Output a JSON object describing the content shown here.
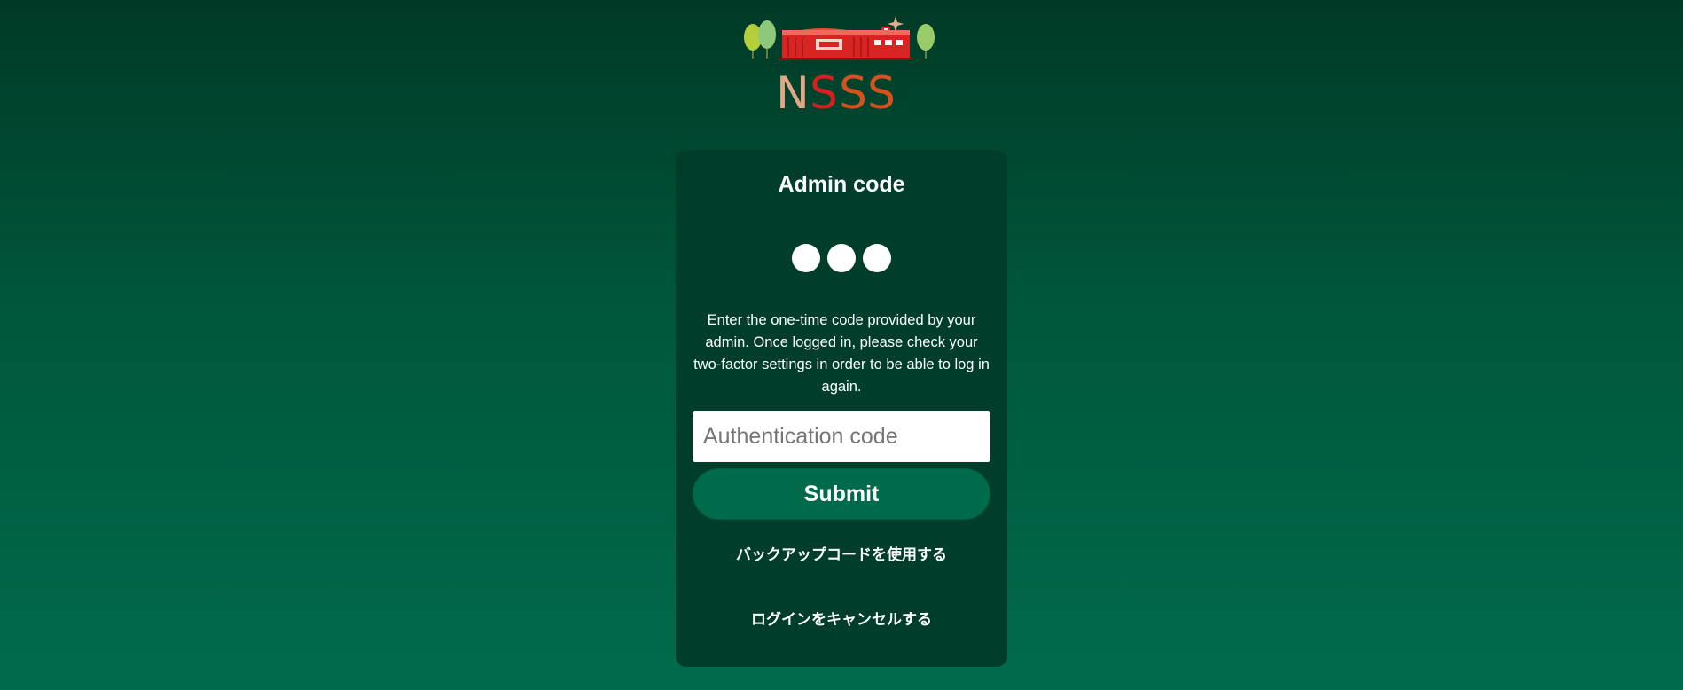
{
  "brand": {
    "logo_letters": [
      "N",
      "S",
      "S",
      "S"
    ],
    "letter_colors": [
      "#e0a888",
      "#d42020",
      "#d4521e",
      "#d4521e"
    ]
  },
  "card": {
    "title": "Admin code",
    "description": "Enter the one-time code provided by your admin. Once logged in, please check your two-factor settings in order to be able to log in again.",
    "code_input": {
      "placeholder": "Authentication code",
      "value": ""
    },
    "submit_label": "Submit",
    "backup_link": "バックアップコードを使用する",
    "cancel_link": "ログインをキャンセルする"
  },
  "colors": {
    "background_top": "#003a27",
    "background_bottom": "#006b4b",
    "card": "#003d2b",
    "button": "#006b4b"
  }
}
